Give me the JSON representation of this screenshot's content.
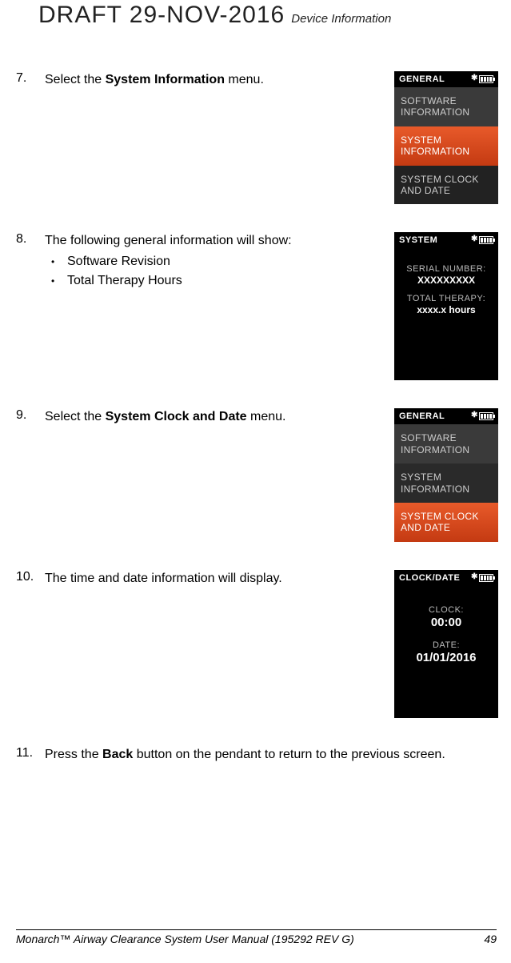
{
  "header": {
    "draft": "DRAFT 29-NOV-2016",
    "section": "Device Information"
  },
  "steps": {
    "s7": {
      "num": "7.",
      "pre": "Select the ",
      "bold": "System Information",
      "post": " menu."
    },
    "s8": {
      "num": "8.",
      "text": "The following general information will show:",
      "b1": "Software Revision",
      "b2": "Total Therapy Hours"
    },
    "s9": {
      "num": "9.",
      "pre": "Select the ",
      "bold": "System Clock and Date",
      "post": " menu."
    },
    "s10": {
      "num": "10.",
      "text": "The time and date information will display."
    },
    "s11": {
      "num": "11.",
      "pre": "Press the ",
      "bold": "Back",
      "post": " button on the pendant to return to the previous screen."
    }
  },
  "screens": {
    "s7": {
      "header": "GENERAL",
      "item1": "SOFTWARE INFORMATION",
      "item2": "SYSTEM INFORMATION",
      "item3": "SYSTEM CLOCK AND DATE"
    },
    "s8": {
      "header": "SYSTEM",
      "label1": "SERIAL NUMBER:",
      "value1": "XXXXXXXXX",
      "label2": "TOTAL THERAPY:",
      "value2": "xxxx.x hours"
    },
    "s9": {
      "header": "GENERAL",
      "item1": "SOFTWARE INFORMATION",
      "item2": "SYSTEM INFORMATION",
      "item3": "SYSTEM CLOCK AND DATE"
    },
    "s10": {
      "header": "CLOCK/DATE",
      "label1": "CLOCK:",
      "value1": "00:00",
      "label2": "DATE:",
      "value2": "01/01/2016"
    }
  },
  "footer": {
    "left": "Monarch™ Airway Clearance System User Manual (195292 REV G)",
    "right": "49"
  }
}
